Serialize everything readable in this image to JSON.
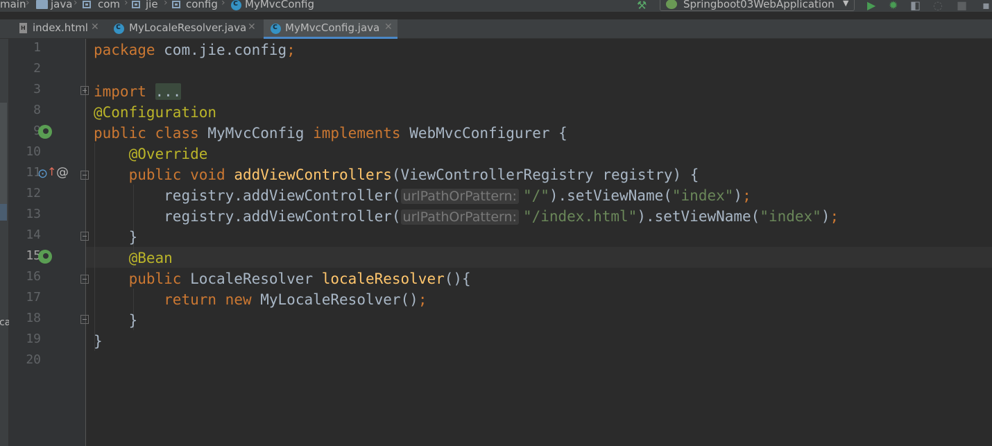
{
  "breadcrumbs": [
    "main",
    "java",
    "com",
    "jie",
    "config",
    "MyMvcConfig"
  ],
  "run_config": {
    "label": "Springboot03WebApplication"
  },
  "tabs": [
    {
      "label": "index.html",
      "active": false
    },
    {
      "label": "MyLocaleResolver.java",
      "active": false
    },
    {
      "label": "MyMvcConfig.java",
      "active": true
    }
  ],
  "gutter": {
    "line_numbers": [
      "1",
      "2",
      "3",
      "8",
      "9",
      "10",
      "11",
      "12",
      "13",
      "14",
      "15",
      "16",
      "17",
      "18",
      "19",
      "20"
    ],
    "current_line": "15"
  },
  "left_strip": {
    "text": "ca"
  },
  "code": {
    "l1": {
      "kw": "package",
      "pkg": " com.jie.config",
      "semi": ";"
    },
    "l3": {
      "kw": "import",
      "folded": "..."
    },
    "l8": {
      "ann": "@Configuration"
    },
    "l9": {
      "kw1": "public",
      "kw2": "class",
      "cls": " MyMvcConfig ",
      "kw3": "implements",
      "iface": " WebMvcConfigurer {"
    },
    "l10": {
      "ann": "@Override"
    },
    "l11": {
      "kw1": "public",
      "kw2": "void",
      "fn": "addViewControllers",
      "params": "(ViewControllerRegistry registry) {"
    },
    "l12": {
      "call": "registry.addViewController(",
      "hint": "urlPathOrPattern:",
      "str1": "\"/\"",
      "mid": ").setViewName(",
      "str2": "\"index\"",
      "end": ")",
      "semi": ";"
    },
    "l13": {
      "call": "registry.addViewController(",
      "hint": "urlPathOrPattern:",
      "str1": "\"/index.html\"",
      "mid": ").setViewName(",
      "str2": "\"index\"",
      "end": ")",
      "semi": ";"
    },
    "l14": {
      "text": "}"
    },
    "l15": {
      "ann": "@Bean"
    },
    "l16": {
      "kw": "public",
      "type": " LocaleResolver ",
      "fn": "localeResolver",
      "rest": "(){"
    },
    "l17": {
      "kw1": "return",
      "kw2": "new",
      "rest": " MyLocaleResolver()",
      "semi": ";"
    },
    "l18": {
      "text": "}"
    },
    "l19": {
      "text": "}"
    }
  },
  "colors": {
    "keyword": "#cc7832",
    "annotation": "#bbb529",
    "function": "#ffc66d",
    "string": "#6a8759",
    "text": "#a9b7c6",
    "background": "#2b2b2b"
  }
}
